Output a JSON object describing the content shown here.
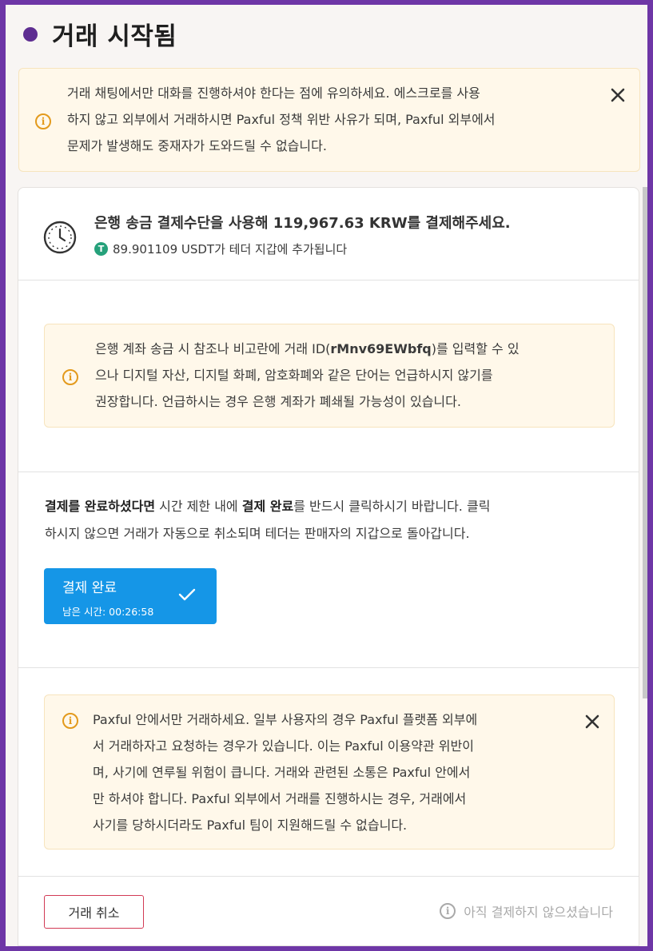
{
  "header": {
    "title": "거래 시작됨"
  },
  "top_alert": {
    "lines": [
      "거래 채팅에서만 대화를 진행하셔야 한다는 점에 유의하세요. 에스크로를 사용",
      "하지 않고 외부에서 거래하시면 Paxful 정책 위반 사유가 되며, Paxful 외부에서",
      "문제가 발생해도 중재자가 도와드릴 수 없습니다."
    ]
  },
  "payment": {
    "title": "은행 송금 결제수단을 사용해 119,967.63 KRW를 결제해주세요.",
    "subtitle": "89.901109 USDT가 테더 지갑에 추가됩니다",
    "token_letter": "T"
  },
  "reference_alert": {
    "line1_prefix": "은행 계좌 송금 시 참조나 비고란에 거래 ID(",
    "trade_id": "rMnv69EWbfq",
    "line1_suffix": ")를 입력할 수 있",
    "line2": "으나 디지털 자산, 디지털 화폐, 암호화폐와 같은 단어는 언급하시지 않기를",
    "line3": "권장합니다. 언급하시는 경우 은행 계좌가 폐쇄될 가능성이 있습니다."
  },
  "instruction": {
    "bold1": "결제를 완료하셨다면",
    "text1": " 시간 제한 내에 ",
    "bold2": "결제 완료",
    "text2": "를 반드시 클릭하시기 바랍니다. 클릭",
    "line2": "하시지 않으면 거래가 자동으로 취소되며 테더는 판매자의 지갑으로 돌아갑니다."
  },
  "complete_button": {
    "label": "결제 완료",
    "timer": "남은 시간: 00:26:58"
  },
  "paxful_alert": {
    "lines": [
      "Paxful 안에서만 거래하세요. 일부 사용자의 경우 Paxful 플랫폼 외부에",
      "서 거래하자고 요청하는 경우가 있습니다. 이는 Paxful 이용약관 위반이",
      "며, 사기에 연루될 위험이 큽니다. 거래와 관련된 소통은 Paxful 안에서",
      "만 하셔야 합니다. Paxful 외부에서 거래를 진행하시는 경우, 거래에서",
      "사기를 당하시더라도 Paxful 팀이 지원해드릴 수 없습니다."
    ]
  },
  "footer": {
    "cancel_label": "거래 취소",
    "status_text": "아직 결제하지 않으셨습니다"
  },
  "colors": {
    "frame": "#6e36a6",
    "accent_blue": "#1596e7",
    "warning": "#e39a1c",
    "cancel_border": "#d23a55",
    "tether": "#26a17b"
  }
}
